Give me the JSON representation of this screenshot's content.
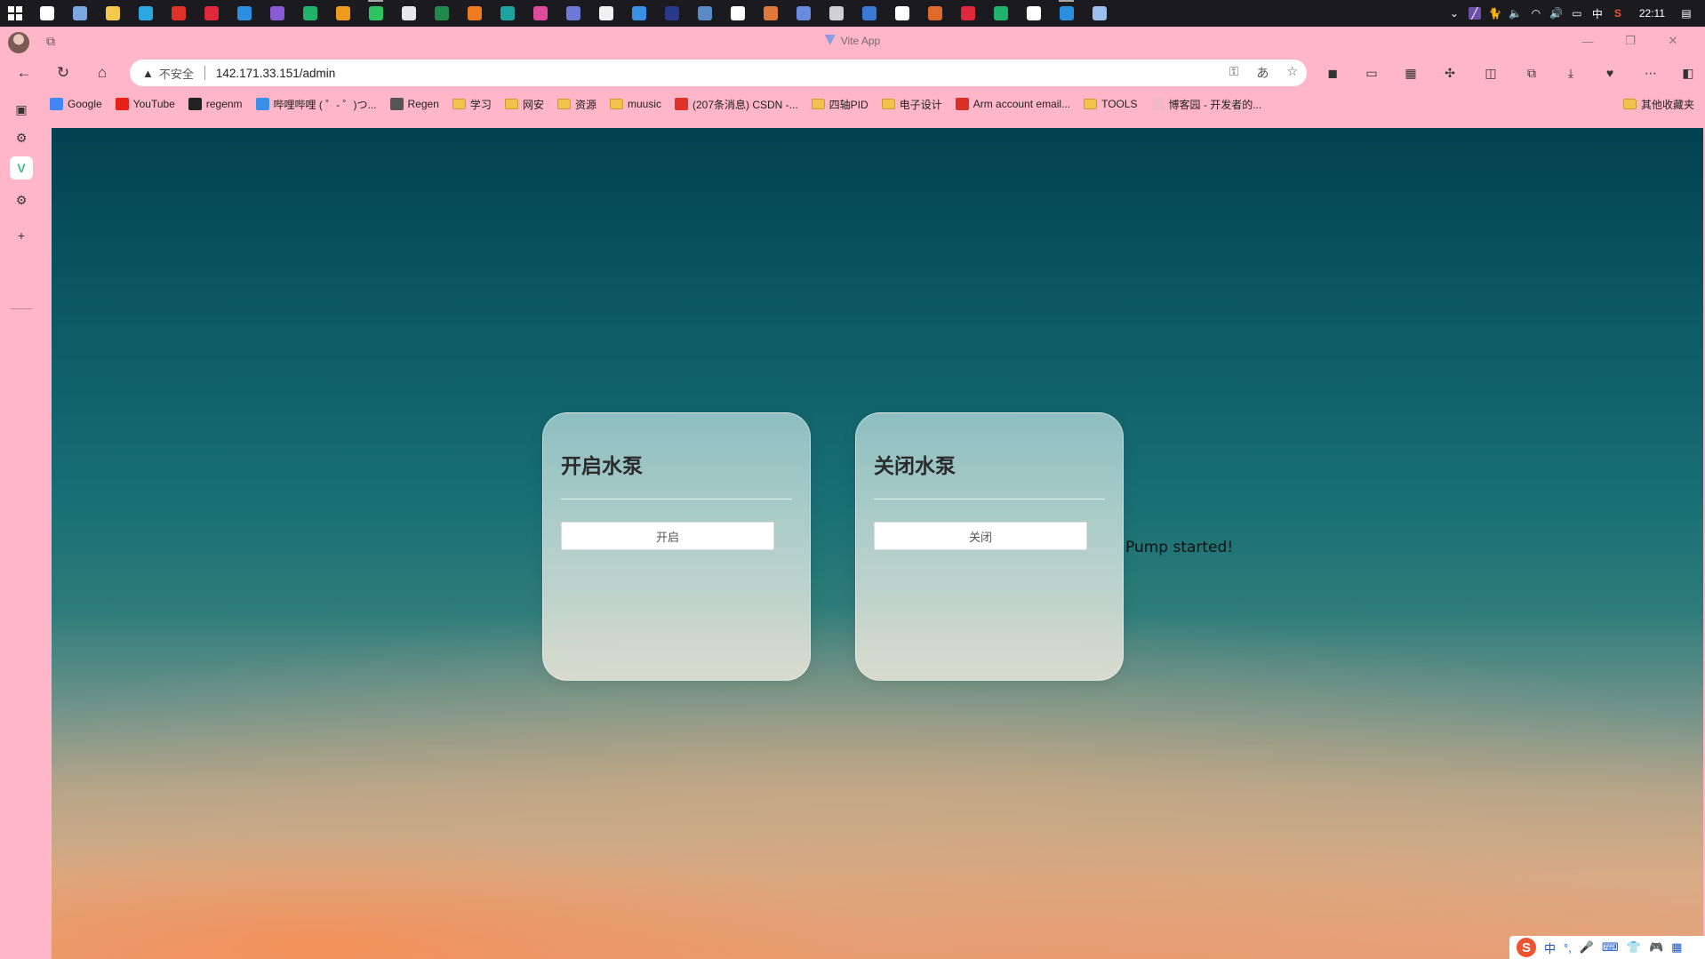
{
  "taskbar": {
    "clock": "22:11",
    "ime_lang": "中",
    "apps": [
      {
        "name": "search-app",
        "color": "#ffffff"
      },
      {
        "name": "pen-app",
        "color": "#7ba7e0"
      },
      {
        "name": "file-explorer",
        "color": "#f3c84b"
      },
      {
        "name": "edge-browser",
        "color": "#2aa9e0"
      },
      {
        "name": "wps-app",
        "color": "#e0322a"
      },
      {
        "name": "xmind-app",
        "color": "#e0283c"
      },
      {
        "name": "vscode-app",
        "color": "#2a8fe0"
      },
      {
        "name": "vs-app",
        "color": "#8a5ad6"
      },
      {
        "name": "green-app",
        "color": "#21b36b"
      },
      {
        "name": "orange-app",
        "color": "#f09a1e"
      },
      {
        "name": "wechat-app",
        "color": "#2ec461"
      },
      {
        "name": "notepad-app",
        "color": "#e8e8e8"
      },
      {
        "name": "excel-app",
        "color": "#1f8a4c"
      },
      {
        "name": "tool-app",
        "color": "#f07a1e"
      },
      {
        "name": "terminal-app",
        "color": "#1fa3a0"
      },
      {
        "name": "pink-app",
        "color": "#e04a9a"
      },
      {
        "name": "bug-app",
        "color": "#6a7ad6"
      },
      {
        "name": "qq-app",
        "color": "#f0f0f0"
      },
      {
        "name": "blue-circle-app",
        "color": "#3a8fe6"
      },
      {
        "name": "dark-app",
        "color": "#2a3a8a"
      },
      {
        "name": "steam-app",
        "color": "#5a8ac6"
      },
      {
        "name": "typora-app",
        "color": "#ffffff"
      },
      {
        "name": "fox-app",
        "color": "#e07a3a"
      },
      {
        "name": "remote-app",
        "color": "#6a8ae0"
      },
      {
        "name": "matlab-app",
        "color": "#d0d0d0"
      },
      {
        "name": "mx-app",
        "color": "#3a7ad6"
      },
      {
        "name": "cloud-app",
        "color": "#ffffff"
      },
      {
        "name": "matlab2-app",
        "color": "#e06a2a"
      },
      {
        "name": "netease-app",
        "color": "#e0283c"
      },
      {
        "name": "green2-app",
        "color": "#21b36b"
      },
      {
        "name": "screen-app",
        "color": "#ffffff"
      },
      {
        "name": "vscode2-app",
        "color": "#2a8fe0"
      },
      {
        "name": "blue2-app",
        "color": "#9ac0f0"
      }
    ]
  },
  "browser": {
    "title": "Vite App",
    "address": {
      "security_label": "不安全",
      "url": "142.171.33.151/admin"
    },
    "favorites": [
      {
        "label": "Google",
        "type": "site",
        "color": "#4285f4"
      },
      {
        "label": "YouTube",
        "type": "site",
        "color": "#e62117"
      },
      {
        "label": "regenm",
        "type": "site",
        "color": "#222222"
      },
      {
        "label": "哔哩哔哩 ( ゜- ゜)つ...",
        "type": "site",
        "color": "#3a8fe6"
      },
      {
        "label": "Regen",
        "type": "site",
        "color": "#555555"
      },
      {
        "label": "学习",
        "type": "folder"
      },
      {
        "label": "网安",
        "type": "folder"
      },
      {
        "label": "资源",
        "type": "folder"
      },
      {
        "label": "muusic",
        "type": "folder"
      },
      {
        "label": "(207条消息) CSDN -...",
        "type": "site",
        "color": "#e0322a"
      },
      {
        "label": "四轴PID",
        "type": "folder"
      },
      {
        "label": "电子设计",
        "type": "folder"
      },
      {
        "label": "Arm account email...",
        "type": "site",
        "color": "#d93025"
      },
      {
        "label": "TOOLS",
        "type": "folder"
      },
      {
        "label": "博客园 - 开发者的...",
        "type": "site",
        "color": "#f2b8c6"
      }
    ],
    "other_favorites": "其他收藏夹"
  },
  "page": {
    "cards": [
      {
        "title": "开启水泵",
        "button": "开启"
      },
      {
        "title": "关闭水泵",
        "button": "关闭"
      }
    ],
    "status": "Pump started!"
  },
  "ime": {
    "lang": "中",
    "punct": "°,"
  }
}
